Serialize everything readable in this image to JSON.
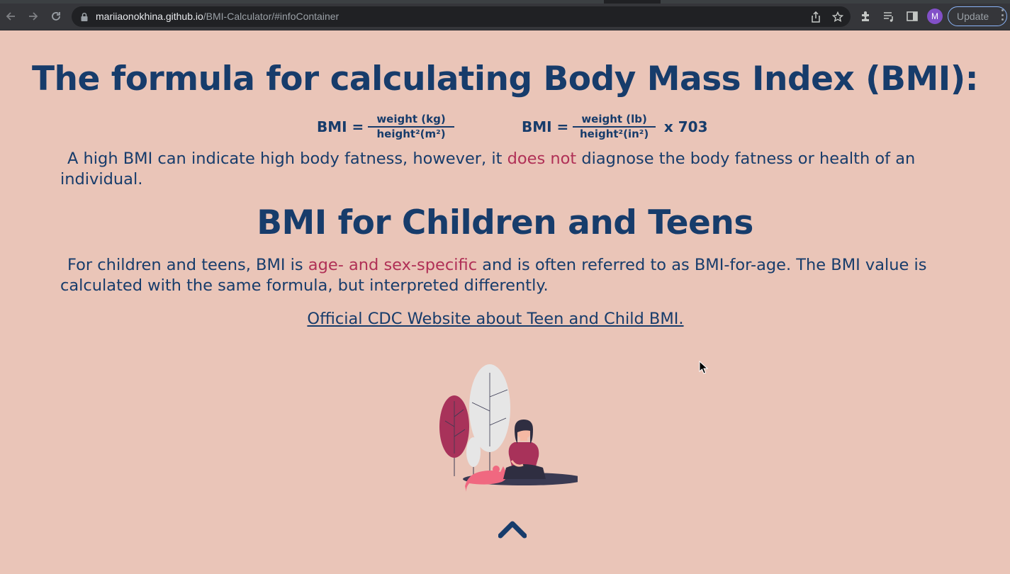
{
  "browser": {
    "url_host": "mariiaonokhina.github.io",
    "url_path": "/BMI-Calculator/#infoContainer",
    "profile_initial": "M",
    "update_label": "Update",
    "icons": {
      "back": "arrow-left-icon",
      "forward": "arrow-right-icon",
      "reload": "reload-icon",
      "lock": "lock-icon",
      "share": "share-icon",
      "bookmark": "star-icon",
      "extensions": "puzzle-icon",
      "media": "playlist-icon",
      "sidepanel": "side-panel-icon",
      "menu": "kebab-menu-icon"
    }
  },
  "content": {
    "title": "The formula for calculating Body Mass Index (BMI):",
    "formula_metric": {
      "lhs": "BMI =",
      "numerator": "weight (kg)",
      "denominator": "height²(m²)"
    },
    "formula_imperial": {
      "lhs": "BMI =",
      "numerator": "weight (lb)",
      "denominator": "height²(in²)",
      "multiplier": "x 703"
    },
    "paragraph1": {
      "before": "A high BMI can indicate high body fatness, however, it ",
      "highlight": "does not",
      "after": " diagnose the body fatness or health of an individual."
    },
    "subtitle": "BMI for Children and Teens",
    "paragraph2": {
      "before": "For children and teens, BMI is ",
      "highlight": "age- and sex-specific",
      "after": " and is often referred to as BMI-for-age. The BMI value is calculated with the same formula, but interpreted differently."
    },
    "cdc_link": "Official CDC Website about Teen and Child BMI.",
    "illustration": "woman-with-cat-and-plants-illustration",
    "scroll_top": "chevron-up-icon"
  },
  "colors": {
    "background": "#eac5b8",
    "primary_text": "#173c6b",
    "accent": "#b03056",
    "chrome_toolbar": "#35363a",
    "omnibox": "#202124"
  }
}
